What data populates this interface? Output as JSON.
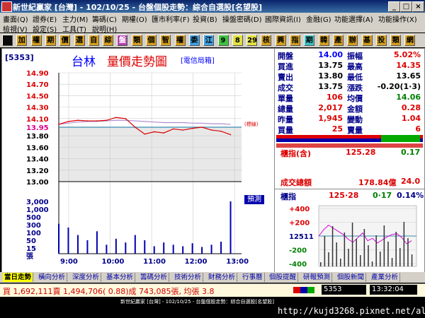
{
  "window": {
    "title": "新世紀贏家 [台灣] - 102/10/25 - 台盤個股走勢：綜合自選股[名望股]"
  },
  "menu1": [
    "畫面(Q)",
    "證券(E)",
    "主力(M)",
    "籌碼(C)",
    "期權(O)",
    "匯市利率(F)",
    "投資(B)",
    "操盤密碼(D)",
    "國際資訊(I)",
    "金融(G)",
    "功能選擇(A)",
    "功能操作(X)"
  ],
  "menu2": [
    "檢視(V)",
    "設定(S)",
    "工具(T)",
    "說明(H)"
  ],
  "toolbar": [
    {
      "t": "",
      "bg": "#0a0a0a",
      "fg": "#fff"
    },
    {
      "t": "加",
      "bg": "#d4a020",
      "fg": "#000"
    },
    {
      "t": "權",
      "bg": "#d4a020",
      "fg": "#000"
    },
    {
      "t": "期",
      "bg": "#d4a020",
      "fg": "#000"
    },
    {
      "t": "價",
      "bg": "#d4a020",
      "fg": "#000"
    },
    {
      "t": "選",
      "bg": "#d4a020",
      "fg": "#000"
    },
    {
      "t": "自",
      "bg": "#d4a020",
      "fg": "#000"
    },
    {
      "t": "綜",
      "bg": "#d4a020",
      "fg": "#000"
    },
    {
      "t": "盤",
      "bg": "#b040b0",
      "fg": "#fff"
    },
    {
      "t": "類",
      "bg": "#d4a020",
      "fg": "#000"
    },
    {
      "t": "個",
      "bg": "#d4a020",
      "fg": "#000"
    },
    {
      "t": "智",
      "bg": "#d4a020",
      "fg": "#000"
    },
    {
      "t": "權",
      "bg": "#d4a020",
      "fg": "#000"
    },
    {
      "t": "委",
      "bg": "#40a0e0",
      "fg": "#000"
    },
    {
      "t": "江",
      "bg": "#40a0e0",
      "fg": "#000"
    },
    {
      "t": "9",
      "bg": "#40c040",
      "fg": "#000"
    },
    {
      "t": "8",
      "bg": "#e0e040",
      "fg": "#000"
    },
    {
      "t": "29",
      "bg": "#e0e040",
      "fg": "#000"
    },
    {
      "t": "核",
      "bg": "#d4a020",
      "fg": "#000"
    },
    {
      "t": "興",
      "bg": "#d4a020",
      "fg": "#000"
    },
    {
      "t": "指",
      "bg": "#d4a020",
      "fg": "#000"
    },
    {
      "t": "期",
      "bg": "#40c0c0",
      "fg": "#000"
    },
    {
      "t": "韓",
      "bg": "#d4a020",
      "fg": "#000"
    },
    {
      "t": "產",
      "bg": "#d4a020",
      "fg": "#000"
    },
    {
      "t": "辦",
      "bg": "#d4a020",
      "fg": "#000"
    },
    {
      "t": "基",
      "bg": "#d4a020",
      "fg": "#000"
    },
    {
      "t": "投",
      "bg": "#d4a020",
      "fg": "#000"
    },
    {
      "t": "類",
      "bg": "#d4a020",
      "fg": "#000"
    },
    {
      "t": "網",
      "bg": "#d4a020",
      "fg": "#000"
    }
  ],
  "chart": {
    "code": "[5353]",
    "name": "台林",
    "title": "量價走勢圖",
    "category": "[電信局箱]",
    "ref_label": "(標線)",
    "estimate_label": "預測",
    "price_ticks": [
      "14.90",
      "14.70",
      "14.50",
      "14.30",
      "14.10",
      "13.95",
      "13.80",
      "13.60",
      "13.40",
      "13.20",
      "13.00"
    ],
    "vol_ticks": [
      "3,000",
      "1,000",
      "500",
      "300",
      "100",
      "50",
      "15",
      "張"
    ],
    "time_ticks": [
      "9:00",
      "10:00",
      "11:00",
      "12:00",
      "13:00"
    ]
  },
  "chart_data": {
    "type": "line",
    "title": "量價走勢圖",
    "x": [
      "9:00",
      "9:15",
      "9:30",
      "9:45",
      "10:00",
      "10:15",
      "10:30",
      "10:45",
      "11:00",
      "11:15",
      "11:30",
      "11:45",
      "12:00",
      "12:15",
      "12:30",
      "12:45",
      "13:00",
      "13:15",
      "13:25"
    ],
    "series": [
      {
        "name": "price",
        "values": [
          14.0,
          14.05,
          14.07,
          14.06,
          14.06,
          14.07,
          14.12,
          14.1,
          13.95,
          13.83,
          13.87,
          13.85,
          13.92,
          13.9,
          13.93,
          13.95,
          13.9,
          13.88,
          13.82
        ]
      },
      {
        "name": "avg",
        "values": [
          14.0,
          14.02,
          14.04,
          14.05,
          14.05,
          14.06,
          14.07,
          14.07,
          14.06,
          14.05,
          14.04,
          14.03,
          14.03,
          14.03,
          14.02,
          14.02,
          14.01,
          14.01,
          14.0
        ]
      }
    ],
    "ref_price": 13.95,
    "ylim": [
      13.0,
      14.9
    ],
    "volume": [
      40,
      35,
      25,
      18,
      30,
      12,
      20,
      15,
      25,
      18,
      10,
      15,
      12,
      10,
      14,
      9,
      12,
      16,
      70
    ]
  },
  "quote": [
    {
      "l": "開盤",
      "v": "14.00",
      "l2": "振幅",
      "v2": "5.02%",
      "c": "#00f",
      "c2": "#d00"
    },
    {
      "l": "買進",
      "v": "13.75",
      "l2": "最高",
      "v2": "14.35",
      "c": "#000",
      "c2": "#d00"
    },
    {
      "l": "賣出",
      "v": "13.80",
      "l2": "最低",
      "v2": "13.65",
      "c": "#000",
      "c2": "#000"
    },
    {
      "l": "成交",
      "v": "13.75",
      "l2": "漲跌",
      "v2": "-0.20(1·3)",
      "c": "#000",
      "c2": "#000"
    },
    {
      "l": "單量",
      "v": "106",
      "l2": "均價",
      "v2": "14.06",
      "c": "#d00",
      "c2": "#008000"
    },
    {
      "l": "總量",
      "v": "2,017",
      "l2": "金額",
      "v2": "0.28",
      "c": "#d00",
      "c2": "#d00"
    },
    {
      "l": "昨量",
      "v": "1,945",
      "l2": "變動",
      "v2": "1.04",
      "c": "#d00",
      "c2": "#d00"
    },
    {
      "l": "買量",
      "v": "25",
      "l2": "賣量",
      "v2": "6",
      "c": "#d00",
      "c2": "#d00"
    }
  ],
  "index": {
    "label": "櫃指(含)",
    "value": "125.28",
    "change": "0.17",
    "turnover_label": "成交總額",
    "turnover": "178.84億",
    "turnover2": "24.0"
  },
  "mini": {
    "title": "櫃指",
    "v1": "125·28",
    "v2": "0·17",
    "v3": "0.14%",
    "ticks": [
      "+400",
      "+200",
      "12511",
      "-200",
      "-400"
    ]
  },
  "tabs": [
    "當日走勢",
    "橫向分析",
    "深度分析",
    "基本分析",
    "籌碼分析",
    "技術分析",
    "財務分析",
    "行事曆",
    "個股提醒",
    "研報預測",
    "個股新聞",
    "產業分析"
  ],
  "status": {
    "text": "買 1,692,111賣 1,494,706( 0.88)成 743,085張, 均張 3.8",
    "code": "5353",
    "time": "13:32:04"
  },
  "footer": {
    "caption": "新世紀贏家 [台灣] - 102/10/25 - 台盤個股走勢：綜合自選股[名望股]",
    "url": "http://kujd3268.pixnet.net/album"
  }
}
